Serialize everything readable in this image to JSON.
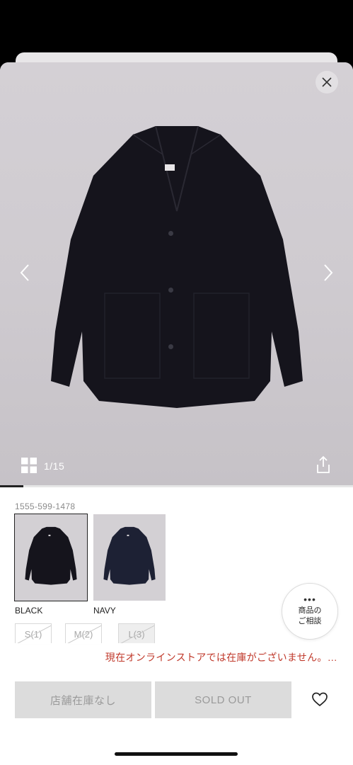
{
  "gallery": {
    "counter": "1/15",
    "progress": 0.067
  },
  "product": {
    "code": "1555-599-1478",
    "colors": [
      {
        "label": "BLACK",
        "selected": true
      },
      {
        "label": "NAVY",
        "selected": false
      }
    ],
    "sizes": [
      "S(1)",
      "M(2)",
      "L(3)"
    ]
  },
  "consult": {
    "dots": "•••",
    "line1": "商品の",
    "line2": "ご相談"
  },
  "bottom": {
    "stock_message": "現在オンラインストアでは在庫がございません。…",
    "store_stock_label": "店舗在庫なし",
    "sold_out_label": "SOLD OUT"
  },
  "colors": {
    "alert": "#c0392b",
    "disabled_button": "#dcdcdc",
    "jacket_black": "#15141c",
    "jacket_navy": "#1d2134"
  },
  "icons": [
    "close-icon",
    "chevron-left-icon",
    "chevron-right-icon",
    "grid-icon",
    "share-icon",
    "heart-icon"
  ]
}
